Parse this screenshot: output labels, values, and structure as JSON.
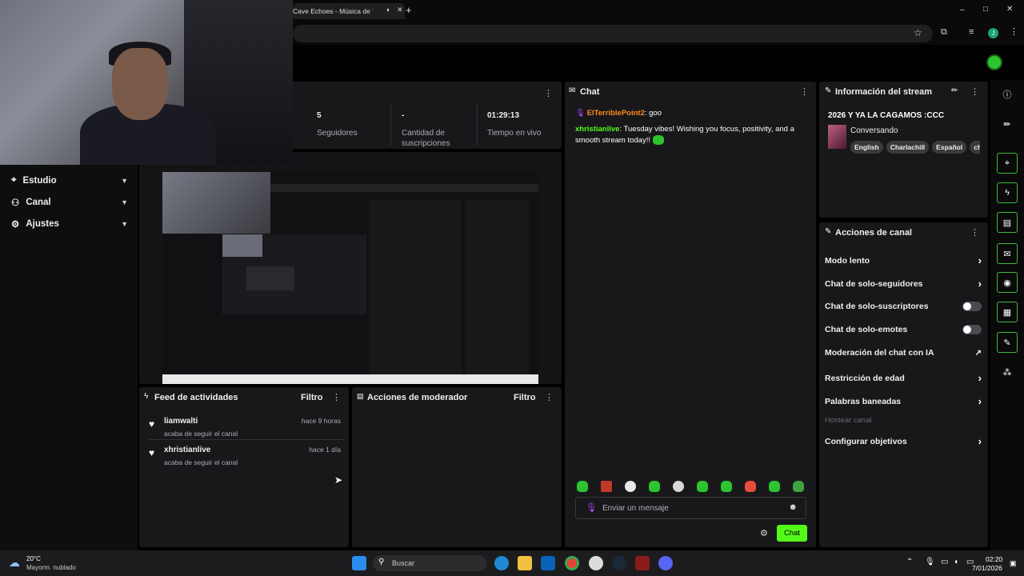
{
  "browser": {
    "tab_title": "Cave Echoes - Música de Vi",
    "new_tab": "+",
    "window_controls": {
      "min": "–",
      "max": "□",
      "close": "✕"
    },
    "profile_initial": "J"
  },
  "stats": [
    {
      "value": "5",
      "label": "Seguidores"
    },
    {
      "value": "-",
      "label": "Cantidad de suscripciones"
    },
    {
      "value": "01:29:13",
      "label": "Tiempo en vivo"
    }
  ],
  "nav": [
    {
      "label": "Estudio"
    },
    {
      "label": "Canal"
    },
    {
      "label": "Ajustes"
    }
  ],
  "chat": {
    "title": "Chat",
    "messages": [
      {
        "user": "ElTerriblePoint2",
        "text": ": goo"
      },
      {
        "user": "xhristianlive",
        "text": ": Tuesday vibes! Wishing you focus, positivity, and a smooth stream today!!"
      }
    ],
    "input_placeholder": "Enviar un mensaje",
    "send_label": "Chat"
  },
  "stream_info": {
    "title": "Información del stream",
    "stream_title": "2026 Y YA LA CAGAMOS :CCC",
    "category": "Conversando",
    "tags": [
      "English",
      "Charlachill",
      "Español",
      "ch"
    ]
  },
  "channel_actions": {
    "title": "Acciones de canal",
    "items": [
      {
        "label": "Modo lento",
        "kind": "arrow"
      },
      {
        "label": "Chat de solo-seguidores",
        "kind": "arrow"
      },
      {
        "label": "Chat de solo-suscriptores",
        "kind": "toggle"
      },
      {
        "label": "Chat de solo-emotes",
        "kind": "toggle"
      },
      {
        "label": "Moderación del chat con IA",
        "kind": "external"
      },
      {
        "label": "Restricción de edad",
        "kind": "arrow"
      },
      {
        "label": "Palabras baneadas",
        "kind": "arrow"
      },
      {
        "label": "Hostear canal",
        "kind": "disabled"
      },
      {
        "label": "Configurar objetivos",
        "kind": "arrow"
      }
    ]
  },
  "activity_feed": {
    "title": "Feed de actividades",
    "filter": "Filtro",
    "items": [
      {
        "user": "liamwalti",
        "action": "acaba de seguir el canal",
        "time": "hace 9 horas"
      },
      {
        "user": "xhristianlive",
        "action": "acaba de seguir el canal",
        "time": "hace 1 día"
      }
    ]
  },
  "mod_actions": {
    "title": "Acciones de moderador",
    "filter": "Filtro"
  },
  "taskbar": {
    "weather_temp": "20°C",
    "weather_desc": "Mayorm. nublado",
    "search": "Buscar",
    "time": "02:20",
    "date": "7/01/2026"
  },
  "colors": {
    "accent": "#53fc18",
    "panel": "#18181b",
    "user1": "#ff8c1a",
    "user2": "#53fc18"
  }
}
